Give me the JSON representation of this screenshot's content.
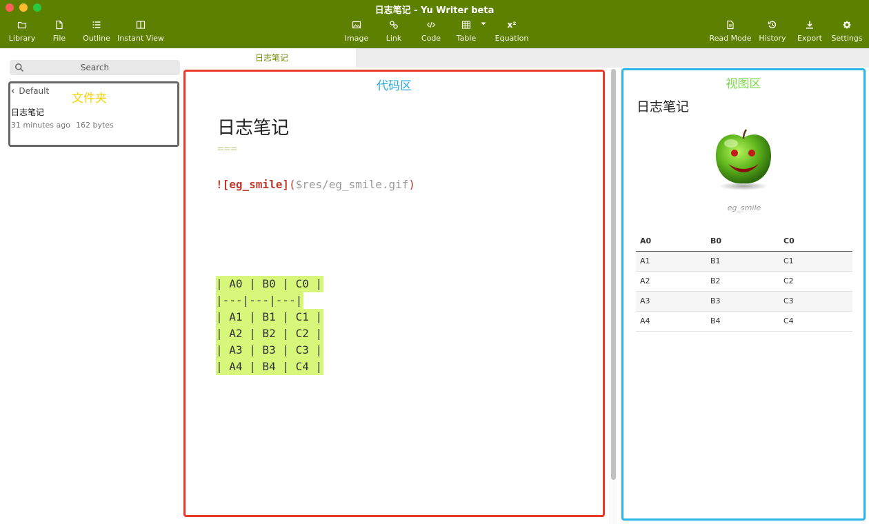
{
  "window": {
    "title": "日志笔记 - Yu Writer beta"
  },
  "toolbar": {
    "left": [
      {
        "label": "Library",
        "icon": "folder-icon"
      },
      {
        "label": "File",
        "icon": "file-icon"
      },
      {
        "label": "Outline",
        "icon": "list-icon"
      },
      {
        "label": "Instant View",
        "icon": "columns-icon"
      }
    ],
    "center": [
      {
        "label": "Image",
        "icon": "image-icon"
      },
      {
        "label": "Link",
        "icon": "link-icon"
      },
      {
        "label": "Code",
        "icon": "code-icon"
      },
      {
        "label": "Table",
        "icon": "table-icon"
      },
      {
        "label": "Equation",
        "icon": "superscript-icon",
        "glyph": "x²"
      }
    ],
    "right": [
      {
        "label": "Read Mode",
        "icon": "document-icon"
      },
      {
        "label": "History",
        "icon": "history-icon"
      },
      {
        "label": "Export",
        "icon": "download-icon"
      },
      {
        "label": "Settings",
        "icon": "gear-icon"
      }
    ]
  },
  "tabs": {
    "active": "日志笔记"
  },
  "sidebar": {
    "search_placeholder": "Search",
    "folder": "Default",
    "folder_annotation": "文件夹",
    "documents": [
      {
        "title": "日志笔记",
        "modified": "31 minutes ago",
        "size": "162 bytes"
      }
    ]
  },
  "editor": {
    "annotation": "代码区",
    "heading": "日志笔记",
    "heading_underline": "===",
    "image_line": {
      "bang_alt": "![eg_smile]",
      "open": "(",
      "path": "$res/eg_smile.gif",
      "close": ")"
    },
    "table_lines": [
      "| A0 | B0 | C0 |",
      "|---|---|---|",
      "| A1 | B1 | C1 |",
      "| A2 | B2 | C2 |",
      "| A3 | B3 | C3 |",
      "| A4 | B4 | C4 |"
    ]
  },
  "preview": {
    "annotation": "视图区",
    "heading": "日志笔记",
    "image_caption": "eg_smile",
    "table": {
      "headers": [
        "A0",
        "B0",
        "C0"
      ],
      "rows": [
        [
          "A1",
          "B1",
          "C1"
        ],
        [
          "A2",
          "B2",
          "C2"
        ],
        [
          "A3",
          "B3",
          "C3"
        ],
        [
          "A4",
          "B4",
          "C4"
        ]
      ]
    }
  },
  "colors": {
    "toolbar": "#5e8000",
    "editor_border": "#e8392a",
    "preview_border": "#28b4e8",
    "code_annotation": "#2aa7d6",
    "view_annotation": "#7bd84a",
    "folder_annotation": "#f2d500",
    "table_highlight": "#d6f77a"
  }
}
